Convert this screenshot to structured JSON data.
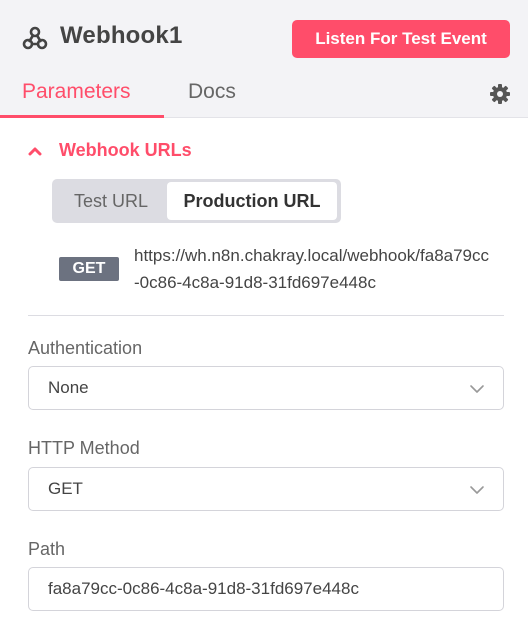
{
  "node": {
    "title": "Webhook1",
    "icon": "webhook-icon"
  },
  "header": {
    "listen_button": "Listen For Test Event"
  },
  "tabs": [
    {
      "label": "Parameters",
      "active": true
    },
    {
      "label": "Docs",
      "active": false
    }
  ],
  "settings_icon": "gear-icon",
  "colors": {
    "accent": "#ff4d6a",
    "badge": "#6c7280",
    "header_bg": "#f3f3f6"
  },
  "webhook_urls": {
    "section_label": "Webhook URLs",
    "expanded": true,
    "toggle": [
      "Test URL",
      "Production URL"
    ],
    "selected": "Production URL",
    "method": "GET",
    "url": "https://wh.n8n.chakray.local/webhook/fa8a79cc-0c86-4c8a-91d8-31fd697e448c"
  },
  "fields": {
    "authentication": {
      "label": "Authentication",
      "value": "None"
    },
    "http_method": {
      "label": "HTTP Method",
      "value": "GET"
    },
    "path": {
      "label": "Path",
      "value": "fa8a79cc-0c86-4c8a-91d8-31fd697e448c"
    }
  }
}
